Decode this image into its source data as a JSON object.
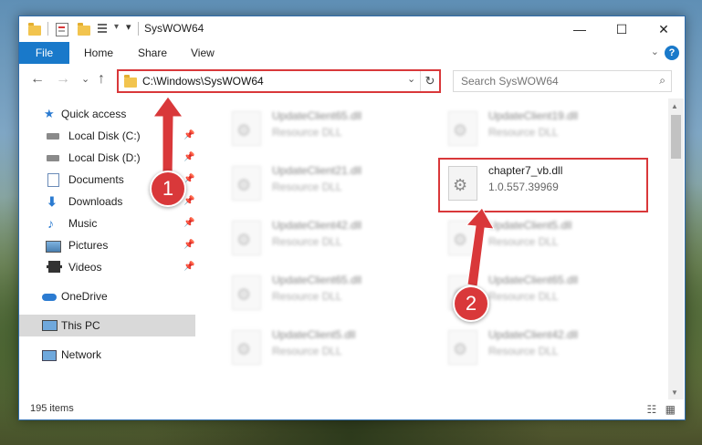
{
  "window": {
    "title": "SysWOW64",
    "minimize": "—",
    "maximize": "☐",
    "close": "✕"
  },
  "ribbon": {
    "tabs": [
      "File",
      "Home",
      "Share",
      "View"
    ],
    "expand_chevron": "⌄",
    "help": "?"
  },
  "navigation": {
    "back": "←",
    "forward": "→",
    "recent": "⌄",
    "up": "↑"
  },
  "address": {
    "path": "C:\\Windows\\SysWOW64",
    "dropdown": "⌄",
    "refresh": "↻"
  },
  "search": {
    "placeholder": "Search SysWOW64",
    "icon": "⌕"
  },
  "sidebar": {
    "items": [
      {
        "label": "Quick access",
        "icon": "star-icon",
        "pinned": false
      },
      {
        "label": "Local Disk (C:)",
        "icon": "drive-icon",
        "pinned": true
      },
      {
        "label": "Local Disk (D:)",
        "icon": "drive-icon",
        "pinned": true
      },
      {
        "label": "Documents",
        "icon": "documents-icon",
        "pinned": true
      },
      {
        "label": "Downloads",
        "icon": "download-icon",
        "pinned": true
      },
      {
        "label": "Music",
        "icon": "music-icon",
        "pinned": true
      },
      {
        "label": "Pictures",
        "icon": "pictures-icon",
        "pinned": true
      },
      {
        "label": "Videos",
        "icon": "videos-icon",
        "pinned": true
      },
      {
        "label": "OneDrive",
        "icon": "cloud-icon",
        "pinned": false
      },
      {
        "label": "This PC",
        "icon": "pc-icon",
        "pinned": false,
        "selected": true
      },
      {
        "label": "Network",
        "icon": "network-icon",
        "pinned": false
      }
    ],
    "pin_glyph": "📌"
  },
  "files": [
    {
      "name": "UpdateClient65.dll",
      "desc": "Resource DLL",
      "blurred": true
    },
    {
      "name": "UpdateClient19.dll",
      "desc": "Resource DLL",
      "blurred": true
    },
    {
      "name": "UpdateClient21.dll",
      "desc": "Resource DLL",
      "blurred": true
    },
    {
      "name": "chapter7_vb.dll",
      "desc": "1.0.557.39969",
      "blurred": false
    },
    {
      "name": "UpdateClient42.dll",
      "desc": "Resource DLL",
      "blurred": true
    },
    {
      "name": "UpdateClient5.dll",
      "desc": "Resource DLL",
      "blurred": true
    },
    {
      "name": "UpdateClient65.dll",
      "desc": "Resource DLL",
      "blurred": true
    },
    {
      "name": "UpdateClient65.dll",
      "desc": "Resource DLL",
      "blurred": true
    },
    {
      "name": "UpdateClient5.dll",
      "desc": "Resource DLL",
      "blurred": true
    },
    {
      "name": "UpdateClient42.dll",
      "desc": "Resource DLL",
      "blurred": true
    }
  ],
  "status": {
    "count": "195 items"
  },
  "callouts": [
    "1",
    "2"
  ],
  "colors": {
    "accent": "#1979ca",
    "highlight": "#d9383a",
    "selected": "#d9d9d9"
  }
}
